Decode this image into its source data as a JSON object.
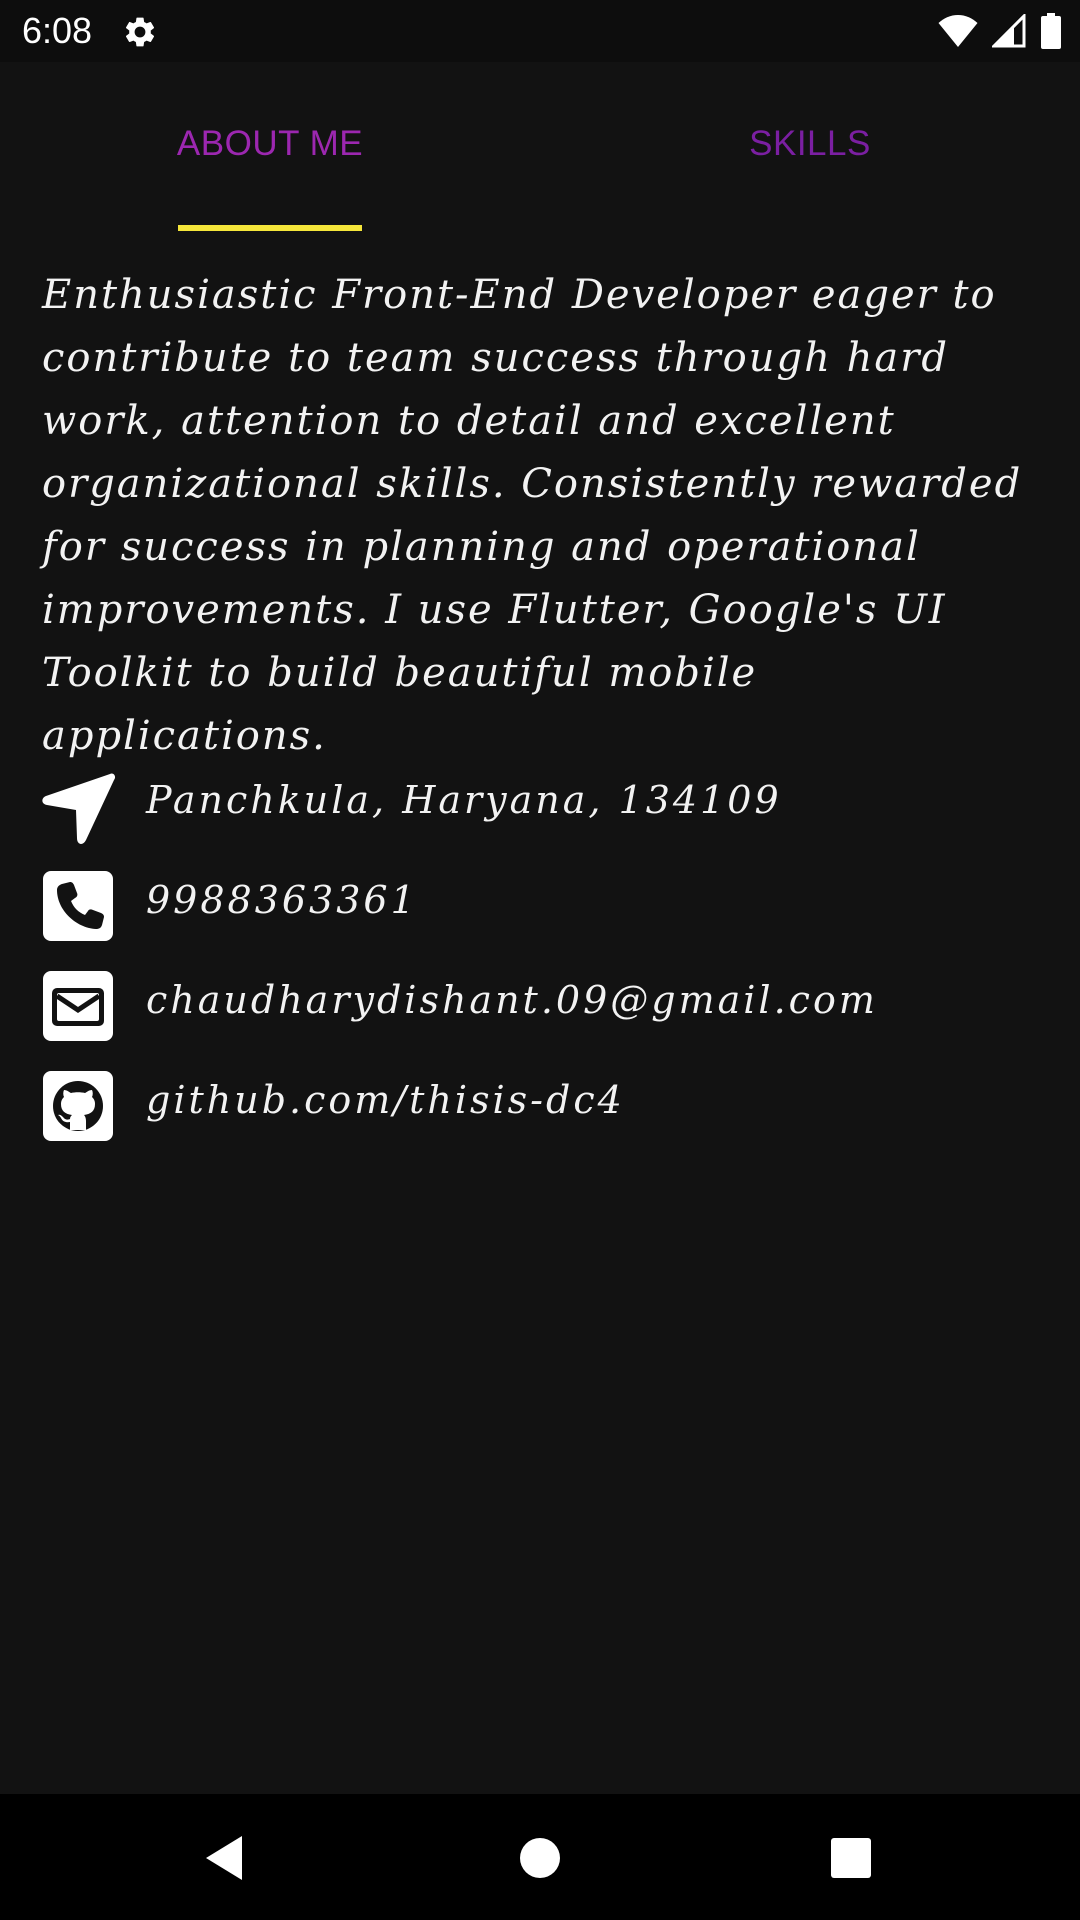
{
  "status_bar": {
    "time": "6:08",
    "icons": [
      "gear-icon",
      "wifi-icon",
      "signal-icon",
      "battery-icon"
    ]
  },
  "tabs": [
    {
      "label": "ABOUT ME",
      "selected": true
    },
    {
      "label": "SKILLS",
      "selected": false
    }
  ],
  "colors": {
    "background": "#121212",
    "tab_text": "#9c27b0",
    "indicator": "#f5e63a",
    "text": "#f2f2f2"
  },
  "about": {
    "text": "Enthusiastic Front-End Developer eager to contribute to team success through hard work, attention to detail and excellent organizational skills. Consistently rewarded for success in planning and operational improvements. I use Flutter, Google's UI Toolkit to build beautiful mobile applications."
  },
  "contacts": [
    {
      "icon": "location-arrow-icon",
      "text": "Panchkula, Haryana, 134109"
    },
    {
      "icon": "phone-icon",
      "text": "9988363361"
    },
    {
      "icon": "email-icon",
      "text": "chaudharydishant.09@gmail.com"
    },
    {
      "icon": "github-icon",
      "text": "github.com/thisis-dc4"
    }
  ],
  "nav_bar": {
    "buttons": [
      "back-icon",
      "home-icon",
      "recents-icon"
    ]
  }
}
